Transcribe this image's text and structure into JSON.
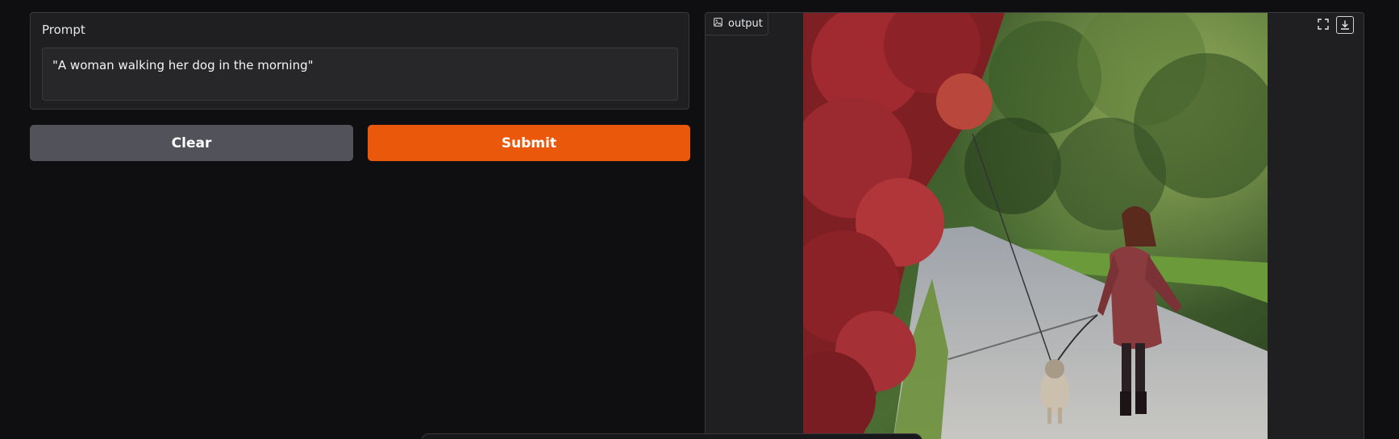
{
  "prompt": {
    "label": "Prompt",
    "value": "\"A woman walking her dog in the morning\""
  },
  "buttons": {
    "clear_label": "Clear",
    "submit_label": "Submit"
  },
  "output": {
    "tab_label": "output",
    "tab_icon": "image-icon",
    "actions": [
      "fullscreen-icon",
      "download-icon"
    ]
  },
  "colors": {
    "accent": "#ea580c",
    "secondary_button": "#52525b",
    "background": "#0f0f11",
    "panel": "#1f1f22"
  }
}
